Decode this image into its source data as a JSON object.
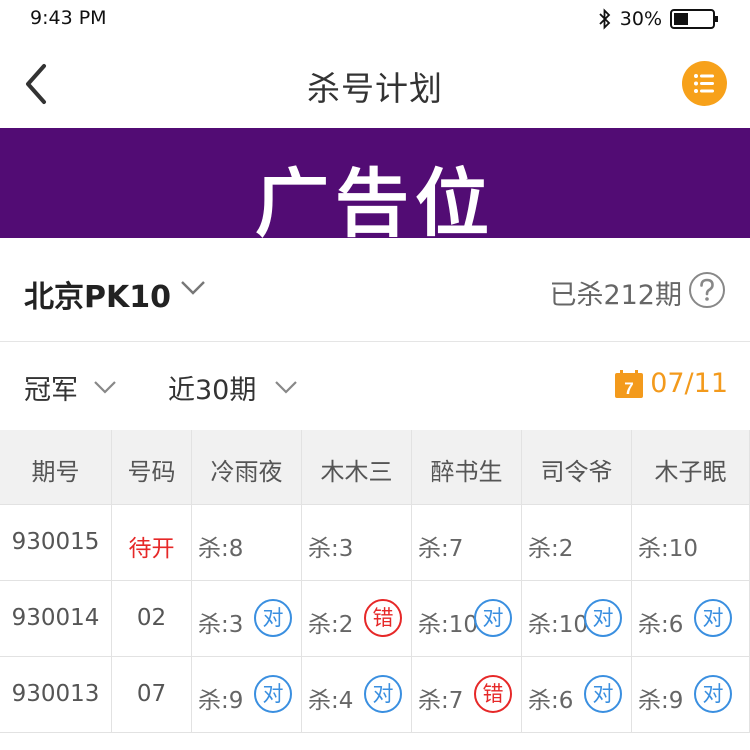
{
  "status_bar": {
    "time": "9:43 PM",
    "battery": "30%"
  },
  "nav": {
    "title": "杀号计划"
  },
  "ad": {
    "text": "广告位"
  },
  "lottery": {
    "name": "北京PK10",
    "killed": "已杀212期"
  },
  "filters": {
    "position": "冠军",
    "period": "近30期",
    "date": "07/11",
    "calendar_day": "7"
  },
  "colors": {
    "accent": "#f7a11a",
    "banner": "#520c74",
    "correct": "#3a8fe0",
    "wrong": "#e62828"
  },
  "table": {
    "headers": [
      "期号",
      "号码",
      "冷雨夜",
      "木木三",
      "醉书生",
      "司令爷",
      "木子眠"
    ],
    "rows": [
      {
        "issue": "930015",
        "number": "待开",
        "pending": true,
        "kills": [
          {
            "text": "杀:8",
            "result": ""
          },
          {
            "text": "杀:3",
            "result": ""
          },
          {
            "text": "杀:7",
            "result": ""
          },
          {
            "text": "杀:2",
            "result": ""
          },
          {
            "text": "杀:10",
            "result": ""
          }
        ]
      },
      {
        "issue": "930014",
        "number": "02",
        "pending": false,
        "kills": [
          {
            "text": "杀:3",
            "result": "对"
          },
          {
            "text": "杀:2",
            "result": "错"
          },
          {
            "text": "杀:10",
            "result": "对"
          },
          {
            "text": "杀:10",
            "result": "对"
          },
          {
            "text": "杀:6",
            "result": "对"
          }
        ]
      },
      {
        "issue": "930013",
        "number": "07",
        "pending": false,
        "kills": [
          {
            "text": "杀:9",
            "result": "对"
          },
          {
            "text": "杀:4",
            "result": "对"
          },
          {
            "text": "杀:7",
            "result": "错"
          },
          {
            "text": "杀:6",
            "result": "对"
          },
          {
            "text": "杀:9",
            "result": "对"
          }
        ]
      }
    ]
  }
}
